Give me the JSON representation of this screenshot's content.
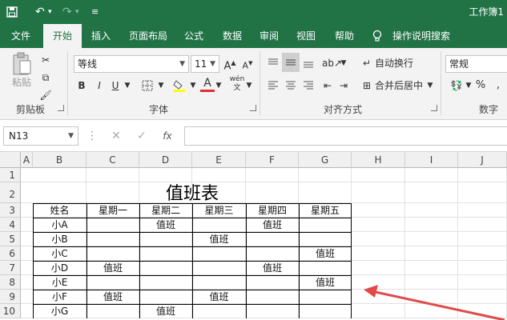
{
  "window": {
    "title": "工作簿1"
  },
  "ribbon": {
    "tabs": [
      {
        "label": "文件"
      },
      {
        "label": "开始"
      },
      {
        "label": "插入"
      },
      {
        "label": "页面布局"
      },
      {
        "label": "公式"
      },
      {
        "label": "数据"
      },
      {
        "label": "审阅"
      },
      {
        "label": "视图"
      },
      {
        "label": "帮助"
      },
      {
        "label": "操作说明搜索"
      }
    ],
    "clipboard": {
      "paste_label": "粘贴",
      "group_label": "剪贴板"
    },
    "font": {
      "name": "等线",
      "size": "11",
      "bold": "B",
      "italic": "I",
      "underline": "U",
      "group_label": "字体"
    },
    "alignment": {
      "wrap_text": "自动换行",
      "merge_center": "合并后居中",
      "group_label": "对齐方式"
    },
    "number": {
      "format": "常规",
      "percent": "%",
      "group_label": "数字"
    }
  },
  "formula_bar": {
    "name_box": "N13",
    "fx": "fx",
    "value": ""
  },
  "grid": {
    "columns": [
      "A",
      "B",
      "C",
      "D",
      "E",
      "F",
      "G",
      "H",
      "I",
      "J"
    ],
    "rows": [
      "1",
      "2",
      "3",
      "4",
      "5",
      "6",
      "7",
      "8",
      "9",
      "10"
    ]
  },
  "sheet": {
    "title": "值班表",
    "headers": [
      "姓名",
      "星期一",
      "星期二",
      "星期三",
      "星期四",
      "星期五"
    ],
    "rows": [
      [
        "小A",
        "",
        "值班",
        "",
        "值班",
        ""
      ],
      [
        "小B",
        "",
        "",
        "值班",
        "",
        ""
      ],
      [
        "小C",
        "",
        "",
        "",
        "",
        "值班"
      ],
      [
        "小D",
        "值班",
        "",
        "",
        "值班",
        ""
      ],
      [
        "小E",
        "",
        "",
        "",
        "",
        "值班"
      ],
      [
        "小F",
        "值班",
        "",
        "值班",
        "",
        ""
      ],
      [
        "小G",
        "",
        "值班",
        "",
        "",
        ""
      ]
    ]
  },
  "annotation": {
    "arrow_color": "#e04a4a"
  }
}
